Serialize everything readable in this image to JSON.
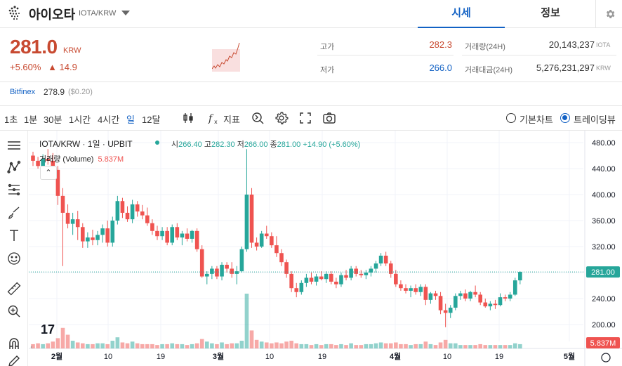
{
  "header": {
    "coin_name": "아이오타",
    "pair": "IOTA/KRW",
    "tabs": [
      {
        "label": "시세",
        "active": true
      },
      {
        "label": "정보",
        "active": false
      }
    ]
  },
  "price": {
    "value": "281.0",
    "unit": "KRW",
    "change_pct": "+5.60%",
    "change_abs": "▲ 14.9",
    "high_label": "고가",
    "high_value": "282.3",
    "low_label": "저가",
    "low_value": "266.0",
    "vol_label": "거래량(24H)",
    "vol_value": "20,143,237",
    "vol_unit": "IOTA",
    "amt_label": "거래대금(24H)",
    "amt_value": "5,276,231,297",
    "amt_unit": "KRW"
  },
  "exchange": {
    "name": "Bitfinex",
    "price": "278.9",
    "sub": "($0.20)"
  },
  "toolbar": {
    "intervals": [
      "1초",
      "1분",
      "30분",
      "1시간",
      "4시간",
      "일",
      "12달"
    ],
    "selected": "일",
    "indicator_label": "지표",
    "radio_basic": "기본차트",
    "radio_trading": "트레이딩뷰"
  },
  "legend": {
    "symbol": "IOTA/KRW · 1일 · UPBIT",
    "o_label": "시",
    "o": "266.40",
    "h_label": "고",
    "h": "282.30",
    "l_label": "저",
    "l": "266.00",
    "c_label": "종",
    "c": "281.00",
    "chg": "+14.90 (+5.60%)",
    "vol_label": "거래량 (Volume)",
    "vol_value": "5.837M"
  },
  "colors": {
    "up": "#26a69a",
    "down": "#ef5350",
    "accent": "#1261c4",
    "price_red": "#c84a31"
  },
  "chart_data": {
    "type": "candlestick",
    "price_ticks": [
      "480.00",
      "440.00",
      "400.00",
      "360.00",
      "320.00",
      "280.00",
      "240.00",
      "200.00"
    ],
    "y_ticks_values": [
      480,
      440,
      400,
      360,
      320,
      280,
      240,
      200
    ],
    "x_ticks": [
      "2월",
      "10",
      "19",
      "3월",
      "10",
      "19",
      "4월",
      "10",
      "19",
      "5월"
    ],
    "last_price_label": "281.00",
    "last_volume_label": "5.837M",
    "ylim": [
      175,
      490
    ],
    "candles": [
      [
        460,
        466,
        444,
        452
      ],
      [
        452,
        458,
        440,
        444
      ],
      [
        444,
        462,
        438,
        455
      ],
      [
        455,
        470,
        446,
        452
      ],
      [
        452,
        464,
        430,
        438
      ],
      [
        438,
        444,
        384,
        398
      ],
      [
        398,
        410,
        290,
        372
      ],
      [
        372,
        385,
        348,
        355
      ],
      [
        355,
        372,
        338,
        362
      ],
      [
        362,
        375,
        330,
        350
      ],
      [
        350,
        356,
        318,
        328
      ],
      [
        328,
        342,
        318,
        334
      ],
      [
        334,
        346,
        322,
        330
      ],
      [
        330,
        344,
        322,
        338
      ],
      [
        338,
        354,
        326,
        348
      ],
      [
        348,
        360,
        320,
        326
      ],
      [
        326,
        366,
        320,
        360
      ],
      [
        360,
        398,
        354,
        390
      ],
      [
        390,
        395,
        364,
        372
      ],
      [
        372,
        382,
        358,
        362
      ],
      [
        362,
        392,
        356,
        385
      ],
      [
        385,
        390,
        366,
        374
      ],
      [
        374,
        384,
        362,
        368
      ],
      [
        368,
        380,
        352,
        356
      ],
      [
        356,
        362,
        338,
        344
      ],
      [
        344,
        352,
        330,
        336
      ],
      [
        336,
        350,
        330,
        344
      ],
      [
        344,
        350,
        322,
        326
      ],
      [
        326,
        354,
        322,
        350
      ],
      [
        350,
        356,
        330,
        334
      ],
      [
        334,
        344,
        322,
        340
      ],
      [
        340,
        348,
        328,
        332
      ],
      [
        332,
        346,
        326,
        344
      ],
      [
        344,
        348,
        312,
        316
      ],
      [
        316,
        322,
        272,
        274
      ],
      [
        274,
        282,
        262,
        278
      ],
      [
        278,
        290,
        270,
        286
      ],
      [
        286,
        290,
        270,
        274
      ],
      [
        274,
        296,
        268,
        292
      ],
      [
        292,
        296,
        280,
        286
      ],
      [
        286,
        296,
        272,
        278
      ],
      [
        278,
        290,
        262,
        282
      ],
      [
        282,
        320,
        280,
        316
      ],
      [
        316,
        470,
        312,
        400
      ],
      [
        400,
        410,
        318,
        326
      ],
      [
        326,
        334,
        314,
        320
      ],
      [
        320,
        344,
        318,
        340
      ],
      [
        340,
        352,
        332,
        336
      ],
      [
        336,
        342,
        318,
        322
      ],
      [
        322,
        336,
        304,
        310
      ],
      [
        310,
        316,
        290,
        296
      ],
      [
        296,
        300,
        272,
        278
      ],
      [
        278,
        282,
        250,
        256
      ],
      [
        256,
        264,
        242,
        250
      ],
      [
        250,
        268,
        246,
        264
      ],
      [
        264,
        278,
        258,
        272
      ],
      [
        272,
        280,
        262,
        266
      ],
      [
        266,
        278,
        260,
        274
      ],
      [
        274,
        282,
        268,
        270
      ],
      [
        270,
        282,
        264,
        278
      ],
      [
        278,
        282,
        262,
        266
      ],
      [
        266,
        272,
        256,
        262
      ],
      [
        262,
        280,
        258,
        276
      ],
      [
        276,
        284,
        268,
        272
      ],
      [
        272,
        290,
        268,
        286
      ],
      [
        286,
        290,
        274,
        278
      ],
      [
        278,
        284,
        272,
        276
      ],
      [
        276,
        284,
        270,
        280
      ],
      [
        280,
        290,
        274,
        286
      ],
      [
        286,
        298,
        280,
        294
      ],
      [
        294,
        310,
        290,
        306
      ],
      [
        306,
        312,
        290,
        294
      ],
      [
        294,
        298,
        272,
        278
      ],
      [
        278,
        284,
        258,
        262
      ],
      [
        262,
        268,
        252,
        256
      ],
      [
        256,
        262,
        248,
        252
      ],
      [
        252,
        260,
        242,
        256
      ],
      [
        256,
        262,
        246,
        250
      ],
      [
        250,
        262,
        244,
        258
      ],
      [
        258,
        262,
        230,
        238
      ],
      [
        238,
        250,
        232,
        248
      ],
      [
        248,
        252,
        238,
        244
      ],
      [
        244,
        250,
        216,
        222
      ],
      [
        222,
        232,
        196,
        218
      ],
      [
        218,
        230,
        210,
        226
      ],
      [
        226,
        248,
        222,
        244
      ],
      [
        244,
        252,
        238,
        248
      ],
      [
        248,
        254,
        236,
        240
      ],
      [
        240,
        252,
        236,
        250
      ],
      [
        250,
        260,
        242,
        246
      ],
      [
        246,
        250,
        230,
        234
      ],
      [
        234,
        240,
        226,
        228
      ],
      [
        228,
        236,
        222,
        232
      ],
      [
        232,
        238,
        224,
        230
      ],
      [
        230,
        248,
        228,
        242
      ],
      [
        242,
        246,
        236,
        240
      ],
      [
        240,
        250,
        236,
        246
      ],
      [
        246,
        272,
        244,
        268
      ],
      [
        268,
        282,
        262,
        281
      ]
    ],
    "volumes": [
      0.5,
      0.6,
      0.5,
      0.6,
      0.8,
      1.2,
      2.4,
      1.6,
      0.9,
      0.7,
      0.6,
      0.5,
      0.5,
      0.6,
      0.6,
      0.5,
      0.9,
      1.3,
      0.7,
      0.6,
      0.8,
      0.6,
      0.5,
      0.5,
      0.5,
      0.4,
      0.5,
      0.5,
      0.6,
      0.5,
      0.5,
      0.4,
      0.5,
      0.6,
      1.1,
      0.8,
      0.6,
      0.5,
      0.7,
      0.5,
      0.6,
      0.6,
      0.9,
      6.4,
      2.1,
      1.0,
      0.8,
      0.7,
      0.6,
      0.7,
      0.6,
      0.8,
      0.9,
      0.6,
      0.5,
      0.5,
      0.4,
      0.5,
      0.4,
      0.5,
      0.5,
      0.4,
      0.5,
      0.4,
      0.6,
      0.4,
      0.4,
      0.5,
      0.5,
      0.6,
      0.7,
      0.6,
      0.6,
      0.7,
      0.5,
      0.5,
      0.4,
      0.5,
      0.5,
      0.8,
      0.5,
      0.4,
      0.7,
      1.0,
      0.6,
      0.6,
      0.4,
      0.4,
      0.4,
      0.4,
      0.5,
      0.4,
      0.4,
      0.4,
      0.4,
      0.4,
      0.4,
      0.6,
      0.5
    ]
  }
}
